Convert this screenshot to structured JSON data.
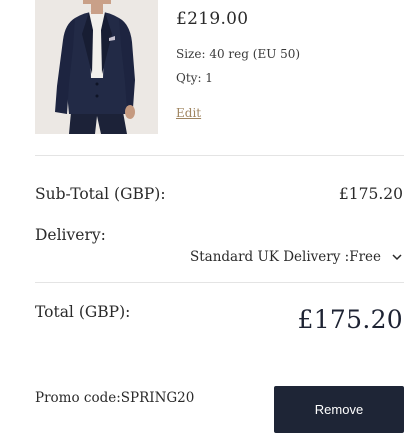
{
  "product": {
    "image_alt": "Navy suit jacket on model",
    "price": "£219.00",
    "size_line": "Size: 40 reg (EU 50)",
    "qty_line": "Qty: 1",
    "edit_label": "Edit"
  },
  "summary": {
    "subtotal_label": "Sub-Total (GBP):",
    "subtotal_value": "£175.20",
    "delivery_label": "Delivery:",
    "delivery_option": "Standard UK Delivery :Free",
    "total_label": "Total (GBP):",
    "total_value": "£175.20"
  },
  "promo": {
    "label": "Promo code:SPRING20",
    "remove_label": "Remove"
  },
  "colors": {
    "button_bg": "#1e2536",
    "edit_link": "#a08560"
  }
}
